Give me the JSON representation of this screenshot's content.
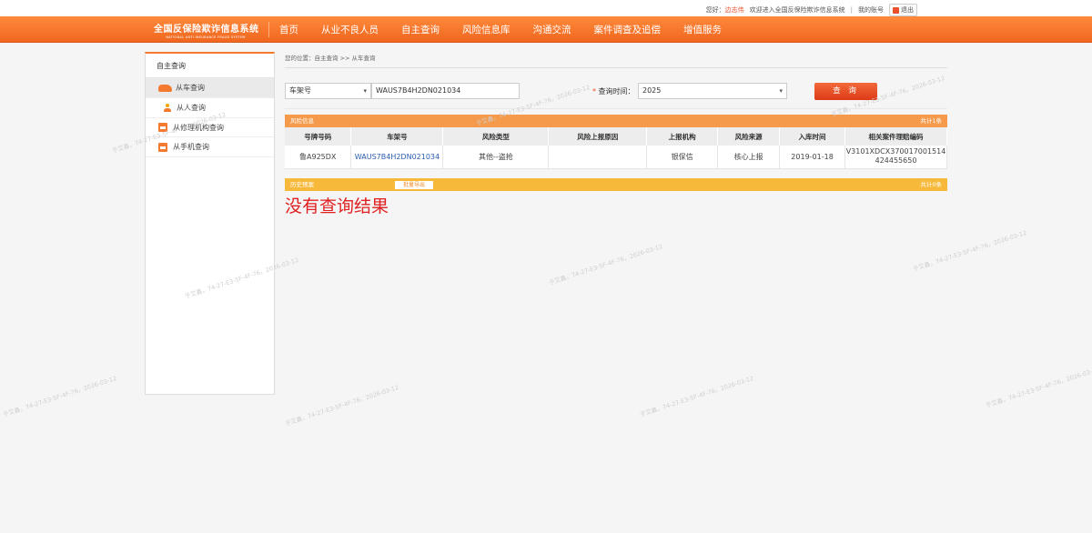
{
  "topbar": {
    "greeting": "您好：",
    "username": "边志伟",
    "welcome": "欢迎进入全国反保险欺诈信息系统",
    "separator": "|",
    "my_account": "我的账号",
    "logout": "退出"
  },
  "logo": {
    "title": "全国反保险欺诈信息系统",
    "subtitle": "NATIONAL ANTI INSURANCE FRAUD SYSTEM"
  },
  "nav": {
    "items": [
      "首页",
      "从业不良人员",
      "自主查询",
      "风险信息库",
      "沟通交流",
      "案件调查及追偿",
      "增值服务"
    ]
  },
  "sidebar": {
    "title": "自主查询",
    "items": [
      {
        "label": "从车查询",
        "icon": "car-icon",
        "active": true
      },
      {
        "label": "从人查询",
        "icon": "person-icon",
        "active": false
      },
      {
        "label": "从修理机构查询",
        "icon": "repair-shop-icon",
        "active": false
      },
      {
        "label": "从手机查询",
        "icon": "phone-icon",
        "active": false
      }
    ]
  },
  "breadcrumb": "您的位置：自主查询 >> 从车查询",
  "search": {
    "type_value": "车架号",
    "vin_value": "WAUS7B4H2DN021034",
    "date_label_star": "*",
    "date_label": "查询时间：",
    "date_value": "2025",
    "query_button": "查 询"
  },
  "risk_panel": {
    "title": "风险信息",
    "count": "共计1条",
    "columns": [
      "号牌号码",
      "车架号",
      "风险类型",
      "风险上报原因",
      "上报机构",
      "风险来源",
      "入库时间",
      "相关案件理赔编码"
    ],
    "rows": [
      {
        "plate": "鲁A925DX",
        "vin": "WAUS7B4H2DN021034",
        "risk_type": "其他--盗抢",
        "reason": "",
        "org": "银保信",
        "source": "核心上报",
        "date": "2019-01-18",
        "claim_code": "V3101XDCX370017001514424455650"
      }
    ]
  },
  "history_panel": {
    "title": "历史预案",
    "export_button": "批量导出",
    "count": "共计0条",
    "no_result": "没有查询结果"
  },
  "colors": {
    "brand_orange": "#f47a2f",
    "query_red": "#dc3a17",
    "link_blue": "#2a5db0",
    "no_result_red": "#e02020"
  },
  "watermark": "于艾鑫，74-27-E3-5F-4F-76，2026-03-12"
}
